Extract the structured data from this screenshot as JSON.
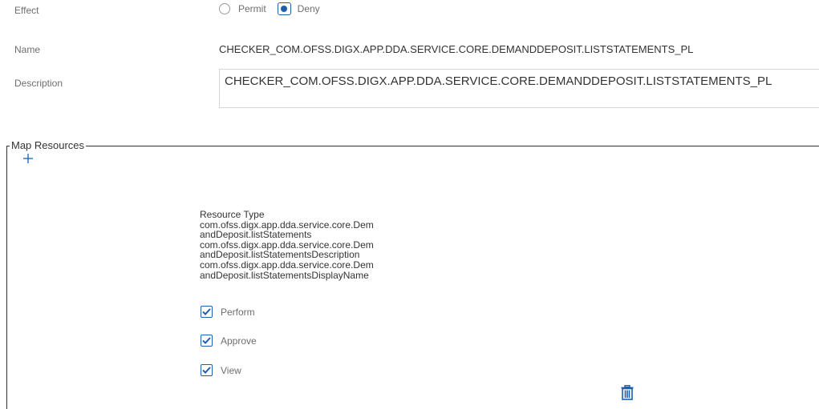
{
  "effect": {
    "label": "Effect",
    "options": [
      {
        "label": "Permit",
        "selected": false
      },
      {
        "label": "Deny",
        "selected": true
      }
    ]
  },
  "name": {
    "label": "Name",
    "value": "CHECKER_COM.OFSS.DIGX.APP.DDA.SERVICE.CORE.DEMANDDEPOSIT.LISTSTATEMENTS_PL"
  },
  "description": {
    "label": "Description",
    "value": "CHECKER_COM.OFSS.DIGX.APP.DDA.SERVICE.CORE.DEMANDDEPOSIT.LISTSTATEMENTS_PL"
  },
  "map_resources": {
    "legend": "Map Resources",
    "add_icon": "plus-icon",
    "resource": {
      "heading": "Resource Type",
      "lines": [
        "com.ofss.digx.app.dda.service.core.Dem",
        "andDeposit.listStatements",
        "com.ofss.digx.app.dda.service.core.Dem",
        "andDeposit.listStatementsDescription",
        "com.ofss.digx.app.dda.service.core.Dem",
        "andDeposit.listStatementsDisplayName"
      ]
    },
    "permissions": [
      {
        "label": "Perform",
        "checked": true
      },
      {
        "label": "Approve",
        "checked": true
      },
      {
        "label": "View",
        "checked": true
      }
    ],
    "delete_icon": "trash-icon"
  },
  "colors": {
    "accent": "#1c5fad",
    "label_text": "#6e6e6e",
    "value_text": "#333333",
    "input_border": "#d6d6d6"
  }
}
